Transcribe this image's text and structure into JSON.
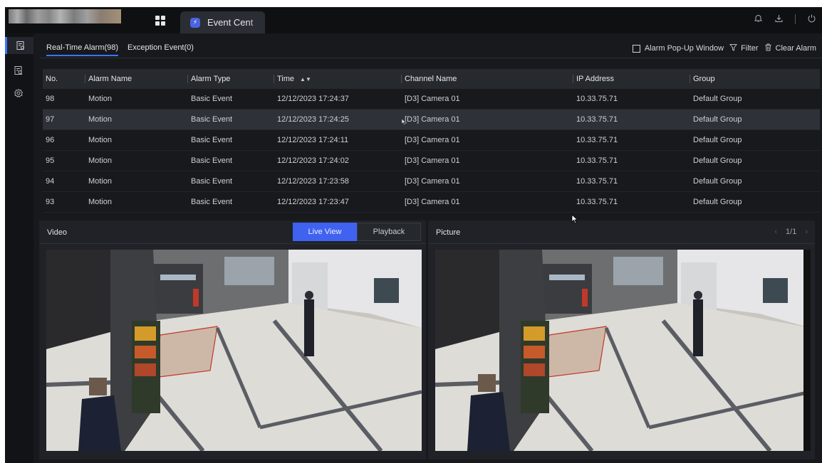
{
  "topbar": {
    "tab_label": "Event Cent",
    "tab_icon": "event-center-icon"
  },
  "subtabs": {
    "realtime": "Real-Time Alarm(98)",
    "exception": "Exception Event(0)"
  },
  "actions": {
    "popup": "Alarm Pop-Up Window",
    "filter": "Filter",
    "clear": "Clear Alarm"
  },
  "table": {
    "columns": [
      "No.",
      "Alarm Name",
      "Alarm Type",
      "Time",
      "Channel Name",
      "IP Address",
      "Group"
    ],
    "rows": [
      [
        "98",
        "Motion",
        "Basic Event",
        "12/12/2023 17:24:37",
        "[D3] Camera 01",
        "10.33.75.71",
        "Default Group"
      ],
      [
        "97",
        "Motion",
        "Basic Event",
        "12/12/2023 17:24:25",
        "[D3] Camera 01",
        "10.33.75.71",
        "Default Group"
      ],
      [
        "96",
        "Motion",
        "Basic Event",
        "12/12/2023 17:24:11",
        "[D3] Camera 01",
        "10.33.75.71",
        "Default Group"
      ],
      [
        "95",
        "Motion",
        "Basic Event",
        "12/12/2023 17:24:02",
        "[D3] Camera 01",
        "10.33.75.71",
        "Default Group"
      ],
      [
        "94",
        "Motion",
        "Basic Event",
        "12/12/2023 17:23:58",
        "[D3] Camera 01",
        "10.33.75.71",
        "Default Group"
      ],
      [
        "93",
        "Motion",
        "Basic Event",
        "12/12/2023 17:23:47",
        "[D3] Camera 01",
        "10.33.75.71",
        "Default Group"
      ]
    ],
    "selected_row": "97"
  },
  "video_panel": {
    "title": "Video",
    "live_view": "Live View",
    "playback": "Playback"
  },
  "picture_panel": {
    "title": "Picture",
    "page": "1/1"
  },
  "colors": {
    "accent": "#3f62f0",
    "background": "#17191d"
  }
}
